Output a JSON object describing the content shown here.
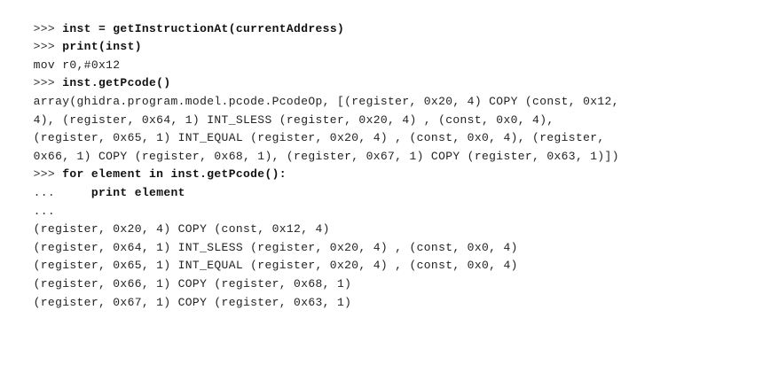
{
  "console": {
    "lines": [
      {
        "prompt": ">>> ",
        "text": "inst = getInstructionAt(currentAddress)",
        "kind": "input"
      },
      {
        "prompt": ">>> ",
        "text": "print(inst)",
        "kind": "input"
      },
      {
        "prompt": "",
        "text": "mov r0,#0x12",
        "kind": "output"
      },
      {
        "prompt": ">>> ",
        "text": "inst.getPcode()",
        "kind": "input"
      },
      {
        "prompt": "",
        "text": "array(ghidra.program.model.pcode.PcodeOp, [(register, 0x20, 4) COPY (const, 0x12,",
        "kind": "output"
      },
      {
        "prompt": "",
        "text": "4), (register, 0x64, 1) INT_SLESS (register, 0x20, 4) , (const, 0x0, 4),",
        "kind": "output"
      },
      {
        "prompt": "",
        "text": "(register, 0x65, 1) INT_EQUAL (register, 0x20, 4) , (const, 0x0, 4), (register,",
        "kind": "output"
      },
      {
        "prompt": "",
        "text": "0x66, 1) COPY (register, 0x68, 1), (register, 0x67, 1) COPY (register, 0x63, 1)])",
        "kind": "output"
      },
      {
        "prompt": ">>> ",
        "text": "for element in inst.getPcode():",
        "kind": "input"
      },
      {
        "prompt": "...     ",
        "text": "print element",
        "kind": "input"
      },
      {
        "prompt": "...",
        "text": "",
        "kind": "input"
      },
      {
        "prompt": "",
        "text": "(register, 0x20, 4) COPY (const, 0x12, 4)",
        "kind": "output"
      },
      {
        "prompt": "",
        "text": "(register, 0x64, 1) INT_SLESS (register, 0x20, 4) , (const, 0x0, 4)",
        "kind": "output"
      },
      {
        "prompt": "",
        "text": "(register, 0x65, 1) INT_EQUAL (register, 0x20, 4) , (const, 0x0, 4)",
        "kind": "output"
      },
      {
        "prompt": "",
        "text": "(register, 0x66, 1) COPY (register, 0x68, 1)",
        "kind": "output"
      },
      {
        "prompt": "",
        "text": "(register, 0x67, 1) COPY (register, 0x63, 1)",
        "kind": "output"
      }
    ]
  }
}
